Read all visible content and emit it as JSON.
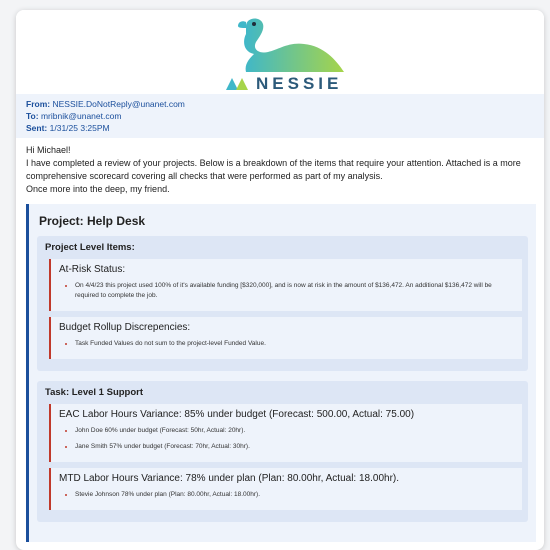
{
  "brand": {
    "name": "NESSIE"
  },
  "email": {
    "from_label": "From:",
    "from": "NESSIE.DoNotReply@unanet.com",
    "to_label": "To:",
    "to": "mribnik@unanet.com",
    "sent_label": "Sent:",
    "sent": "1/31/25 3:25PM"
  },
  "intro": {
    "greeting": "Hi Michael!",
    "body": "I have completed a review of your projects. Below is a breakdown of the items that require your attention. Attached is a more comprehensive scorecard covering all checks that were performed as part of my analysis.",
    "closing": "Once more into the deep, my friend."
  },
  "project": {
    "title": "Project: Help Desk",
    "groups": [
      {
        "title": "Project Level Items:",
        "issues": [
          {
            "title": "At-Risk Status:",
            "items": [
              "On 4/4/23 this project used 100% of it's available funding [$320,000], and is now at risk in the amount of $136,472. An additional $136,472 will be required to complete the job."
            ]
          },
          {
            "title": "Budget Rollup Discrepencies:",
            "items": [
              "Task Funded Values do not sum to the project-level Funded Value."
            ]
          }
        ]
      },
      {
        "title": "Task: Level 1 Support",
        "issues": [
          {
            "title": "EAC Labor Hours Variance: 85% under budget (Forecast: 500.00, Actual: 75.00)",
            "items": [
              "John Doe 60% under budget (Forecast: 50hr, Actual: 20hr).",
              "Jane Smith 57% under budget (Forecast: 70hr, Actual: 30hr)."
            ]
          },
          {
            "title": "MTD Labor Hours Variance: 78% under plan (Plan: 80.00hr, Actual: 18.00hr).",
            "items": [
              "Stevie Johnson 78% under plan (Plan: 80.00hr, Actual: 18.00hr)."
            ]
          }
        ]
      }
    ]
  },
  "colors": {
    "accent": "#1b4f9c",
    "alert": "#c0392b",
    "panel": "#eef3fb"
  }
}
